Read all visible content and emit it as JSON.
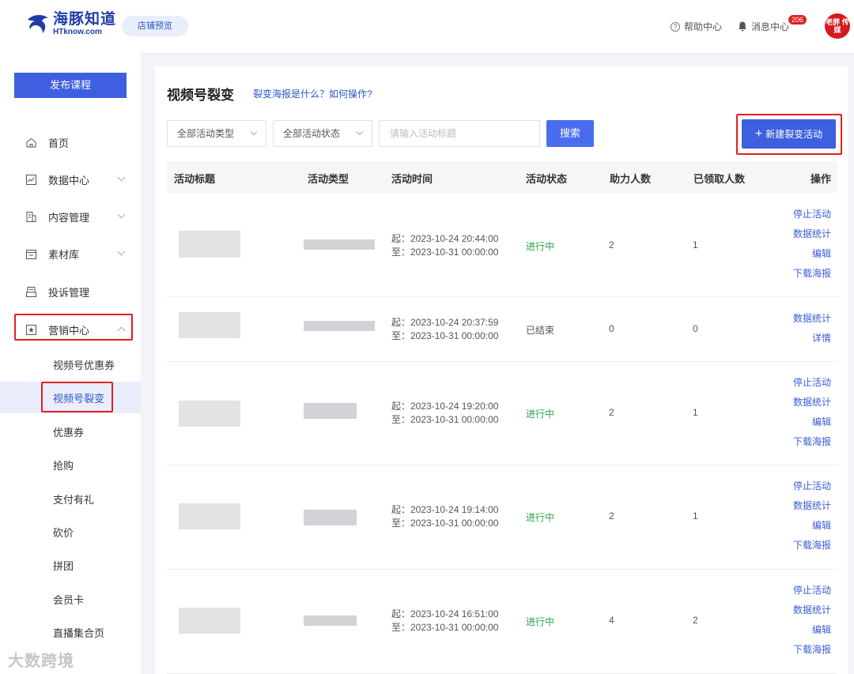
{
  "header": {
    "logo_cn": "海豚知道",
    "logo_en": "HTknow.com",
    "preview_label": "店铺预览",
    "help_label": "帮助中心",
    "message_label": "消息中心",
    "message_count": "206",
    "avatar_text": "老胖 传媒"
  },
  "sidebar": {
    "publish_label": "发布课程",
    "items": [
      {
        "label": "首页",
        "icon": "home-icon"
      },
      {
        "label": "数据中心",
        "icon": "chart-icon"
      },
      {
        "label": "内容管理",
        "icon": "content-icon"
      },
      {
        "label": "素材库",
        "icon": "folder-icon"
      },
      {
        "label": "投诉管理",
        "icon": "complaint-icon"
      },
      {
        "label": "营销中心",
        "icon": "star-icon"
      }
    ],
    "sub_items": [
      "视频号优惠券",
      "视频号裂变",
      "优惠券",
      "抢购",
      "支付有礼",
      "砍价",
      "拼团",
      "会员卡",
      "直播集合页"
    ]
  },
  "main": {
    "title": "视频号裂变",
    "help_link": "裂变海报是什么？如何操作?",
    "filter_type": "全部活动类型",
    "filter_status": "全部活动状态",
    "search_placeholder": "请输入活动标题",
    "search_label": "搜索",
    "new_label": "新建裂变活动",
    "columns": [
      "活动标题",
      "活动类型",
      "活动时间",
      "活动状态",
      "助力人数",
      "已领取人数",
      "操作"
    ],
    "rows": [
      {
        "start": "起：2023-10-24 20:44:00",
        "end": "至：2023-10-31 00:00:00",
        "status": "进行中",
        "helpers": "2",
        "received": "1",
        "ops": [
          "停止活动",
          "数据统计",
          "编辑",
          "下载海报"
        ]
      },
      {
        "start": "起：2023-10-24 20:37:59",
        "end": "至：2023-10-31 00:00:00",
        "status": "已结束",
        "helpers": "0",
        "received": "0",
        "ops": [
          "数据统计",
          "详情"
        ]
      },
      {
        "start": "起：2023-10-24 19:20:00",
        "end": "至：2023-10-31 00:00:00",
        "status": "进行中",
        "helpers": "2",
        "received": "1",
        "ops": [
          "停止活动",
          "数据统计",
          "编辑",
          "下载海报"
        ]
      },
      {
        "start": "起：2023-10-24 19:14:00",
        "end": "至：2023-10-31 00:00:00",
        "status": "进行中",
        "helpers": "2",
        "received": "1",
        "ops": [
          "停止活动",
          "数据统计",
          "编辑",
          "下载海报"
        ]
      },
      {
        "start": "起：2023-10-24 16:51:00",
        "end": "至：2023-10-31 00:00:00",
        "status": "进行中",
        "helpers": "4",
        "received": "2",
        "ops": [
          "停止活动",
          "数据统计",
          "编辑",
          "下载海报"
        ]
      }
    ]
  },
  "watermark": "大数跨境",
  "colors": {
    "primary": "#3d5fe0",
    "link": "#2d55c9",
    "active_status": "#2aa34a",
    "highlight": "#e0201c"
  }
}
